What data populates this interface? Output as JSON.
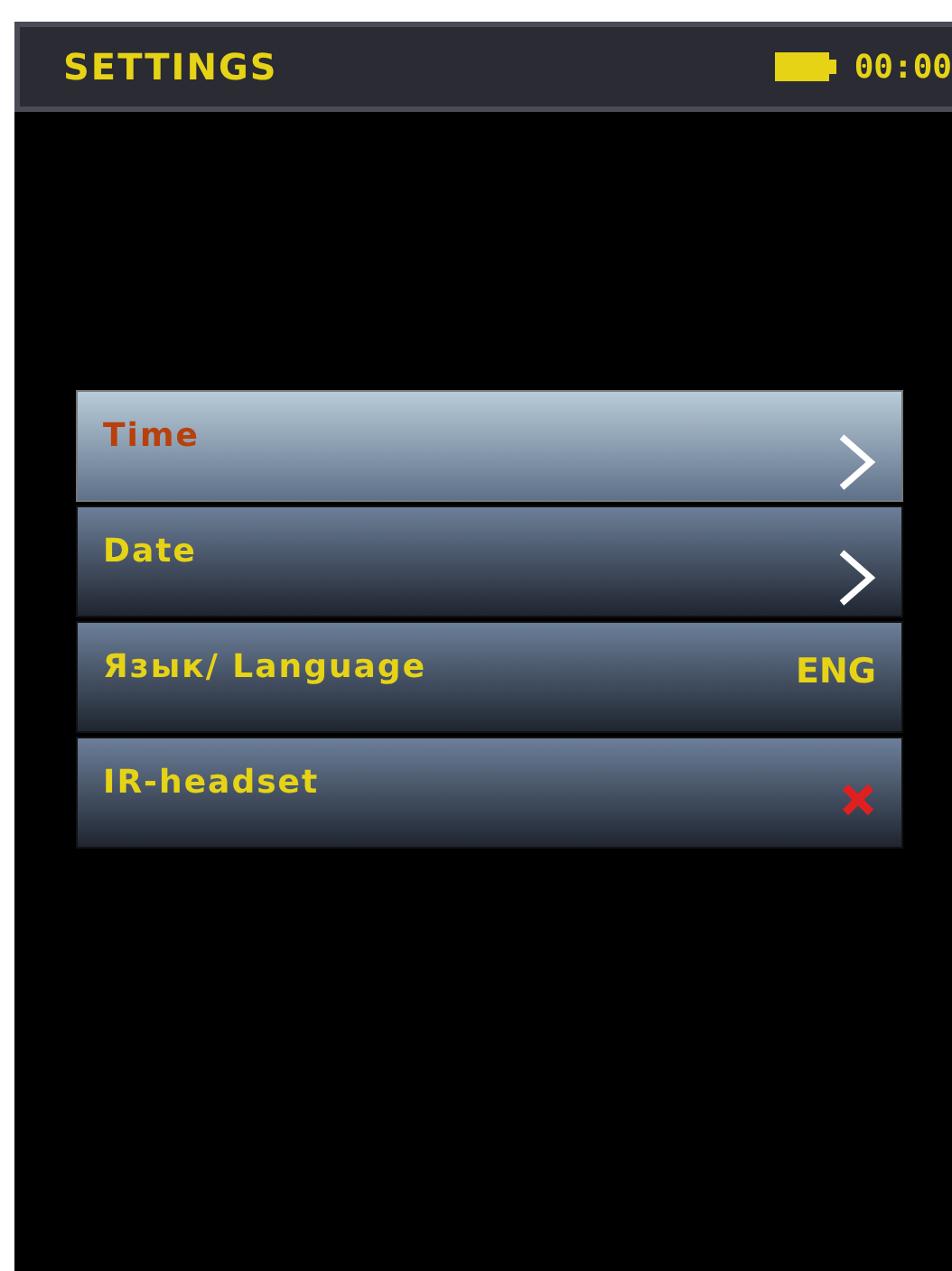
{
  "header": {
    "title": "SETTINGS",
    "time": "00:00"
  },
  "menu": [
    {
      "label": "Time",
      "kind": "link",
      "selected": true
    },
    {
      "label": "Date",
      "kind": "link",
      "selected": false
    },
    {
      "label": "Язык/ Language",
      "kind": "value",
      "value": "ENG",
      "selected": false
    },
    {
      "label": "IR-headset",
      "kind": "toggle",
      "on": false,
      "selected": false
    }
  ]
}
